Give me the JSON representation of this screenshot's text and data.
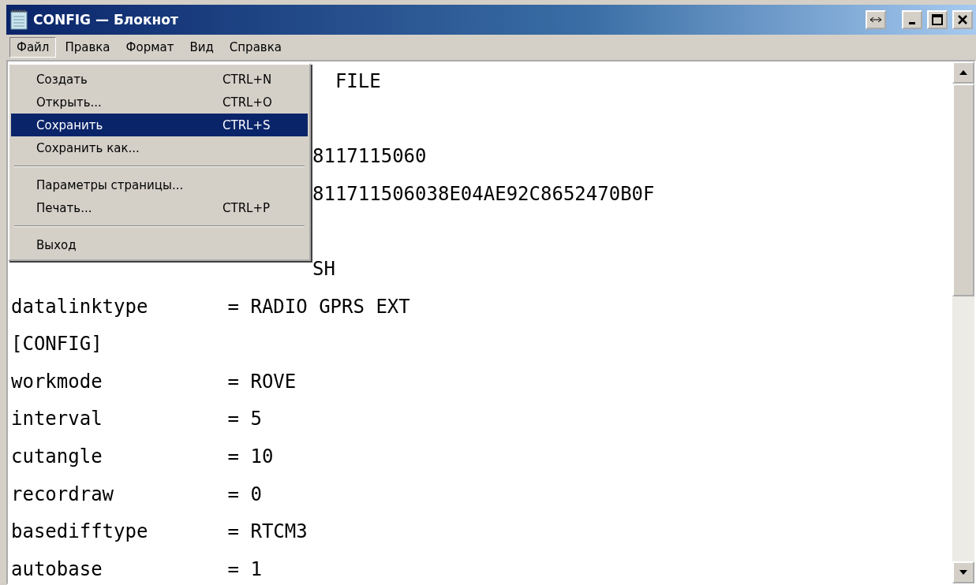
{
  "window": {
    "title": "CONFIG — Блокнот"
  },
  "menu_bar": [
    {
      "label": "Файл",
      "selected": true
    },
    {
      "label": "Правка",
      "selected": false
    },
    {
      "label": "Формат",
      "selected": false
    },
    {
      "label": "Вид",
      "selected": false
    },
    {
      "label": "Справка",
      "selected": false
    }
  ],
  "file_menu": [
    {
      "kind": "item",
      "label": "Создать",
      "shortcut": "CTRL+N",
      "selected": false
    },
    {
      "kind": "item",
      "label": "Открыть...",
      "shortcut": "CTRL+O",
      "selected": false
    },
    {
      "kind": "item",
      "label": "Сохранить",
      "shortcut": "CTRL+S",
      "selected": true
    },
    {
      "kind": "item",
      "label": "Сохранить как...",
      "selected": false
    },
    {
      "kind": "separator"
    },
    {
      "kind": "item",
      "label": "Параметры страницы...",
      "selected": false
    },
    {
      "kind": "item",
      "label": "Печать...",
      "shortcut": "CTRL+P",
      "selected": false
    },
    {
      "kind": "separator"
    },
    {
      "kind": "item",
      "label": "Выход",
      "selected": false
    }
  ],
  "editor_lines": [
    {
      "kind": "covered",
      "text": "  FILE"
    },
    {
      "kind": "covered"
    },
    {
      "kind": "covered",
      "text": "8117115060"
    },
    {
      "kind": "covered",
      "text": "811711506038E04AE92C8652470B0F"
    },
    {
      "kind": "covered"
    },
    {
      "kind": "covered",
      "text": "SH"
    },
    {
      "kind": "full",
      "text": "datalinktype       = RADIO GPRS EXT"
    },
    {
      "kind": "full",
      "text": "[CONFIG]"
    },
    {
      "kind": "full",
      "text": "workmode           = ROVE"
    },
    {
      "kind": "full",
      "text": "interval           = 5"
    },
    {
      "kind": "full",
      "text": "cutangle           = 10"
    },
    {
      "kind": "full",
      "text": "recordraw          = 0"
    },
    {
      "kind": "full",
      "text": "basedifftype       = RTCM3"
    },
    {
      "kind": "full",
      "text": "autobase           = 1"
    }
  ]
}
